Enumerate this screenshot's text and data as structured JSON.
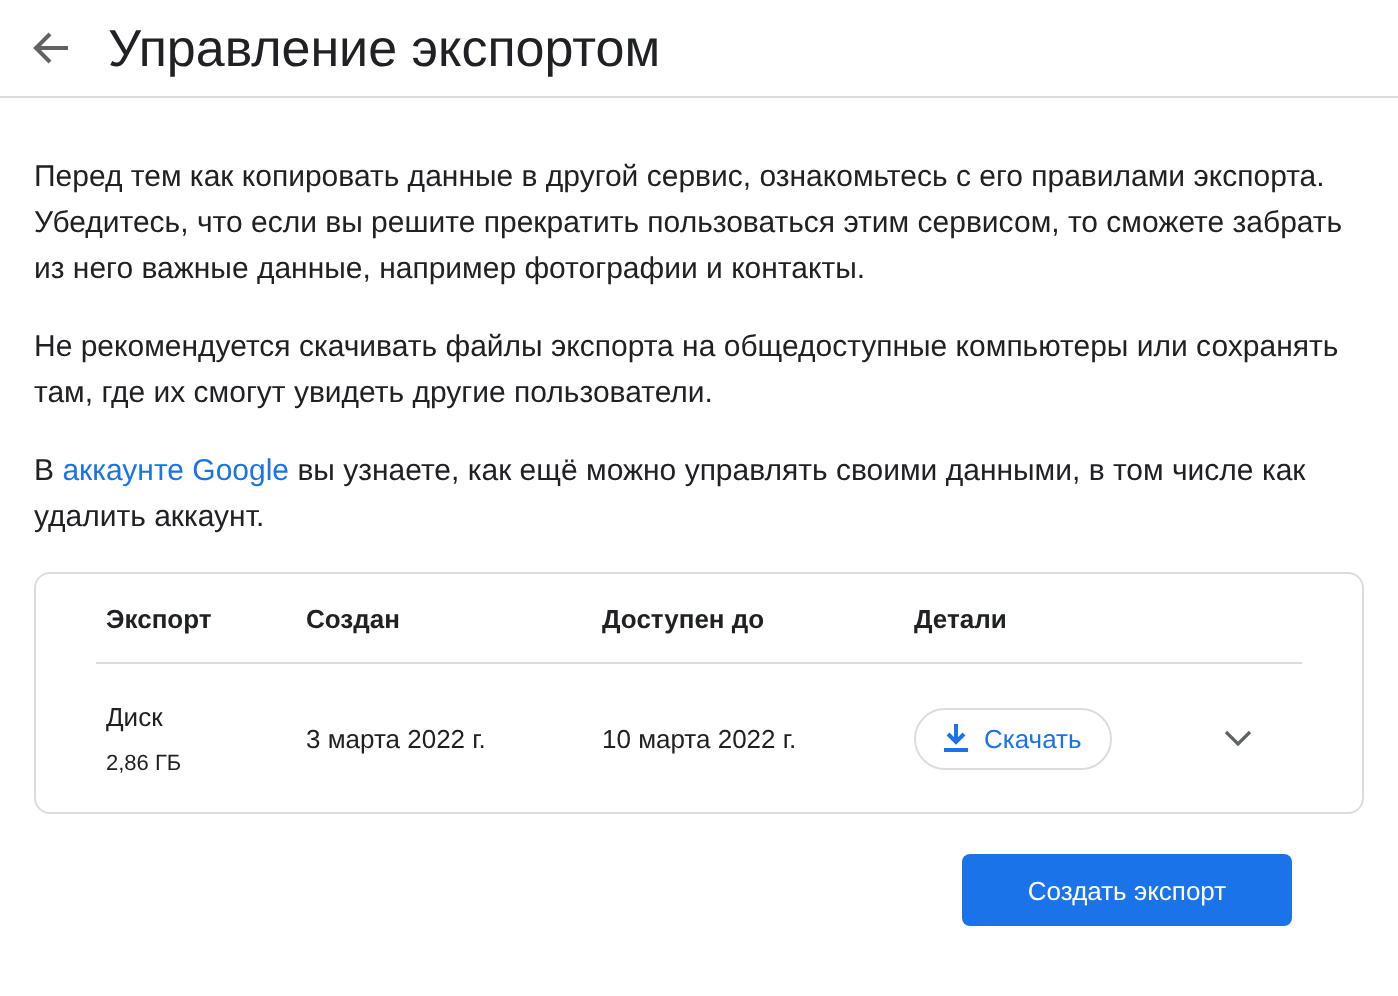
{
  "header": {
    "title": "Управление экспортом"
  },
  "paragraphs": [
    {
      "text": "Перед тем как копировать данные в другой сервис, ознакомьтесь с его правилами экспорта. Убедитесь, что если вы решите прекратить пользоваться этим сервисом, то сможете забрать из него важные данные, например фотографии и контакты."
    },
    {
      "text": "Не рекомендуется скачивать файлы экспорта на общедоступные компьютеры или сохранять там, где их смогут увидеть другие пользователи."
    },
    {
      "before": "В ",
      "link": "аккаунте Google",
      "after": " вы узнаете, как ещё можно управлять своими данными, в том числе как удалить аккаунт."
    }
  ],
  "table": {
    "columns": [
      "Экспорт",
      "Создан",
      "Доступен до",
      "Детали"
    ],
    "rows": [
      {
        "name": "Диск",
        "size": "2,86 ГБ",
        "created": "3 марта 2022 г.",
        "available_until": "10 марта 2022 г.",
        "action": "Скачать",
        "expanded": false
      }
    ]
  },
  "create_button": "Создать экспорт"
}
